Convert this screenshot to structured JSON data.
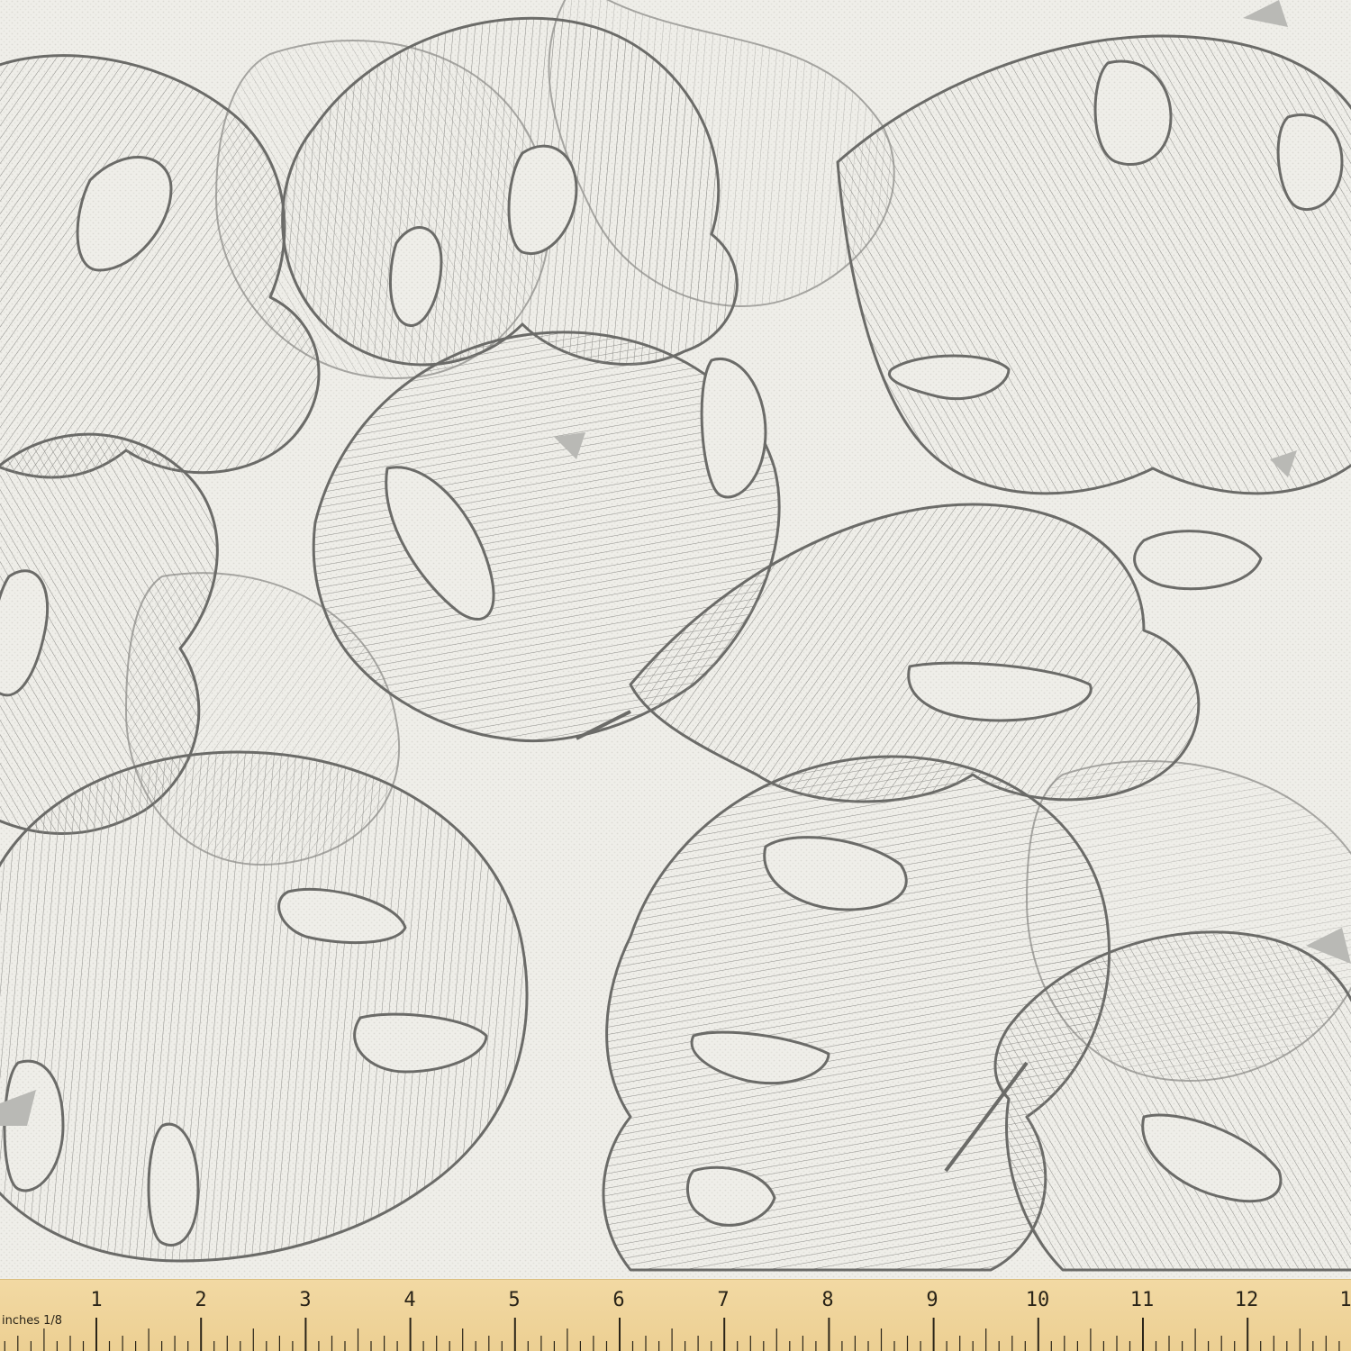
{
  "image": {
    "subject": "monstera-leaf-line-art-fabric",
    "colors": {
      "fabric": "#efeee9",
      "line": "#6b6b68",
      "shadow": "#b9b9b5",
      "ruler": "#f2d9a3",
      "ruler_ink": "#2a2418"
    }
  },
  "ruler": {
    "units_label": "inches 1/8",
    "numbers": [
      "1",
      "2",
      "3",
      "4",
      "5",
      "6",
      "7",
      "8",
      "9",
      "10",
      "11",
      "12",
      "1"
    ]
  }
}
